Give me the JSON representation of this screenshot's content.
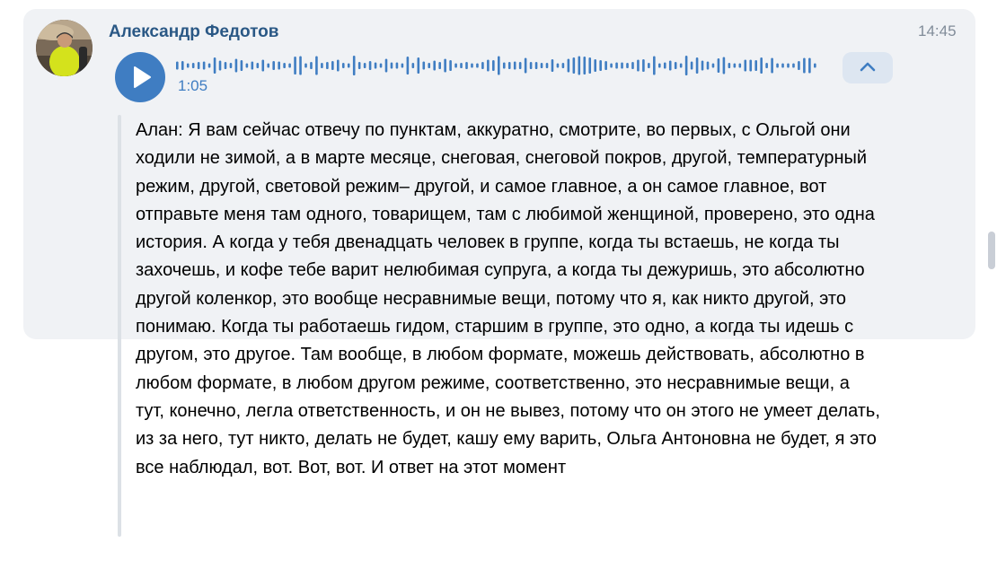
{
  "message": {
    "author": "Александр Федотов",
    "time": "14:45",
    "voice": {
      "duration": "1:05"
    },
    "transcript": "Алан: Я вам сейчас отвечу по пунктам, аккуратно, смотрите, во первых, с Ольгой они ходили не зимой, а в марте месяце, снеговая, снеговой покров, другой, температурный режим, другой, световой режим– другой, и самое главное, а он самое главное, вот отправьте меня там одного, товарищем, там с любимой женщиной, проверено, это одна история. А когда у тебя двенадцать человек в группе, когда ты встаешь, не когда ты захочешь, и кофе тебе варит нелюбимая супруга, а когда ты дежуришь, это абсолютно другой коленкор, это вообще несравнимые вещи, потому что я, как никто другой, это понимаю. Когда ты работаешь гидом, старшим в группе, это одно, а когда ты идешь с другом, это другое. Там вообще, в любом формате, можешь действовать, абсолютно в любом формате, в любом другом режиме, соответственно, это несравнимые вещи, а тут, конечно, легла ответственность, и он не вывез, потому что он этого не умеет делать, из за него, тут никто, делать не будет, кашу ему варить, Ольга Антоновна не будет, я это все наблюдал, вот. Вот, вот. И ответ на этот момент"
  },
  "icons": {
    "play": "play-icon",
    "collapse": "chevron-up-icon"
  },
  "colors": {
    "accent": "#3f7dc2",
    "author": "#2a5885",
    "time": "#818c99",
    "message_bg": "#f0f2f5",
    "collapse_bg": "#dde6f1"
  }
}
